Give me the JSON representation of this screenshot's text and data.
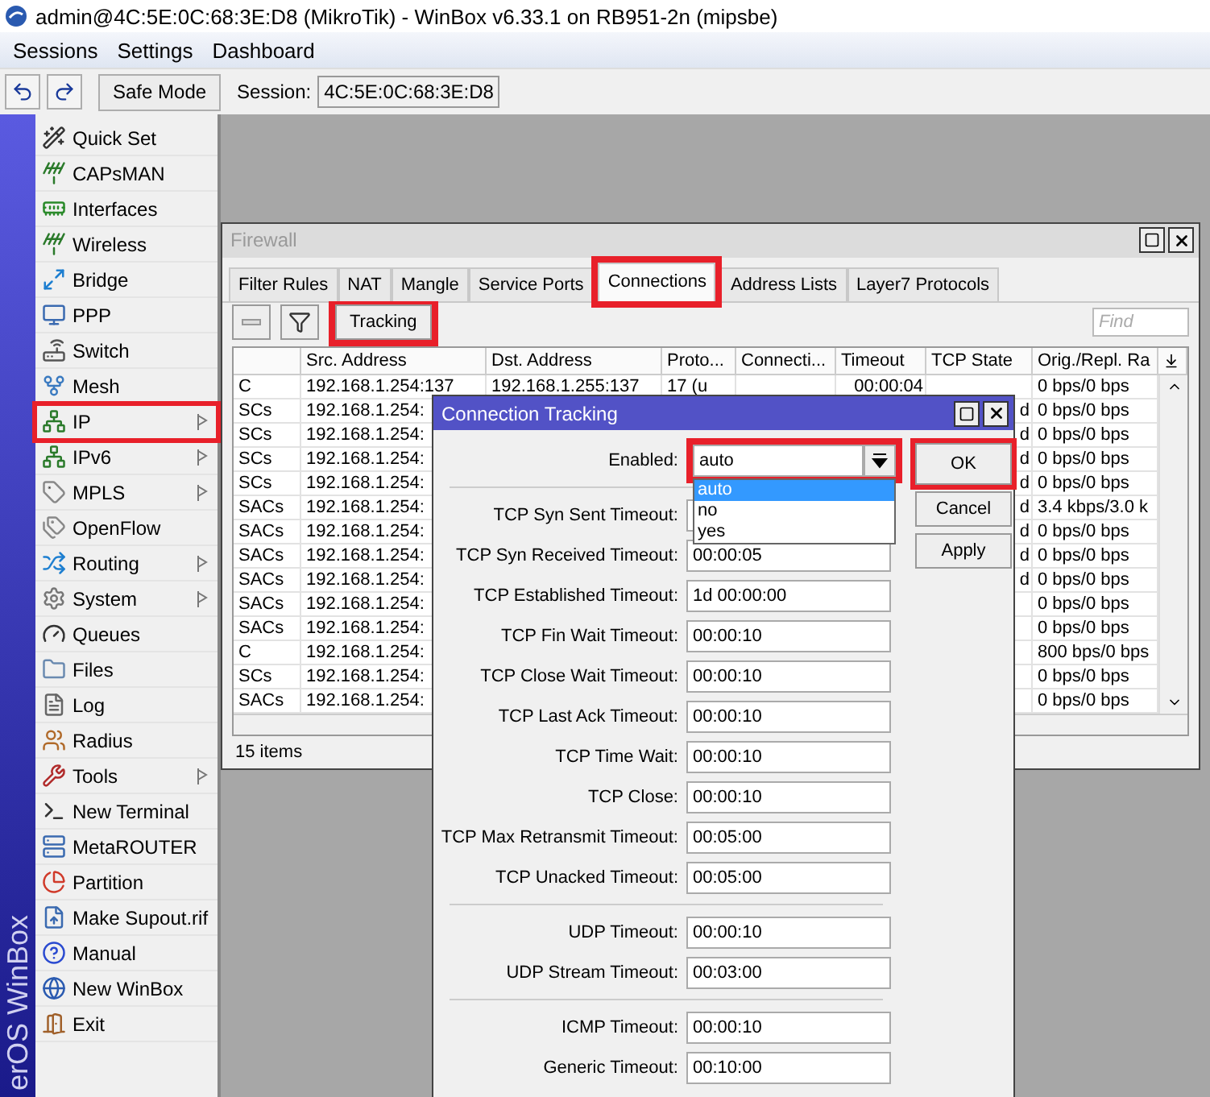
{
  "window": {
    "title": "admin@4C:5E:0C:68:3E:D8 (MikroTik) - WinBox v6.33.1 on RB951-2n (mipsbe)"
  },
  "menu": [
    "Sessions",
    "Settings",
    "Dashboard"
  ],
  "toolbar": {
    "safe_mode": "Safe Mode",
    "session_label": "Session:",
    "session_value": "4C:5E:0C:68:3E:D8"
  },
  "brand": "erOS WinBox",
  "sidebar": {
    "items": [
      {
        "label": "Quick Set",
        "submenu": false,
        "highlighted": false
      },
      {
        "label": "CAPsMAN",
        "submenu": false,
        "highlighted": false
      },
      {
        "label": "Interfaces",
        "submenu": false,
        "highlighted": false
      },
      {
        "label": "Wireless",
        "submenu": false,
        "highlighted": false
      },
      {
        "label": "Bridge",
        "submenu": false,
        "highlighted": false
      },
      {
        "label": "PPP",
        "submenu": false,
        "highlighted": false
      },
      {
        "label": "Switch",
        "submenu": false,
        "highlighted": false
      },
      {
        "label": "Mesh",
        "submenu": false,
        "highlighted": false
      },
      {
        "label": "IP",
        "submenu": true,
        "highlighted": true
      },
      {
        "label": "IPv6",
        "submenu": true,
        "highlighted": false
      },
      {
        "label": "MPLS",
        "submenu": true,
        "highlighted": false
      },
      {
        "label": "OpenFlow",
        "submenu": false,
        "highlighted": false
      },
      {
        "label": "Routing",
        "submenu": true,
        "highlighted": false
      },
      {
        "label": "System",
        "submenu": true,
        "highlighted": false
      },
      {
        "label": "Queues",
        "submenu": false,
        "highlighted": false
      },
      {
        "label": "Files",
        "submenu": false,
        "highlighted": false
      },
      {
        "label": "Log",
        "submenu": false,
        "highlighted": false
      },
      {
        "label": "Radius",
        "submenu": false,
        "highlighted": false
      },
      {
        "label": "Tools",
        "submenu": true,
        "highlighted": false
      },
      {
        "label": "New Terminal",
        "submenu": false,
        "highlighted": false
      },
      {
        "label": "MetaROUTER",
        "submenu": false,
        "highlighted": false
      },
      {
        "label": "Partition",
        "submenu": false,
        "highlighted": false
      },
      {
        "label": "Make Supout.rif",
        "submenu": false,
        "highlighted": false
      },
      {
        "label": "Manual",
        "submenu": false,
        "highlighted": false
      },
      {
        "label": "New WinBox",
        "submenu": false,
        "highlighted": false
      },
      {
        "label": "Exit",
        "submenu": false,
        "highlighted": false
      }
    ]
  },
  "firewall": {
    "title": "Firewall",
    "tabs": [
      {
        "label": "Filter Rules",
        "selected": false,
        "highlighted": false
      },
      {
        "label": "NAT",
        "selected": false,
        "highlighted": false
      },
      {
        "label": "Mangle",
        "selected": false,
        "highlighted": false
      },
      {
        "label": "Service Ports",
        "selected": false,
        "highlighted": false
      },
      {
        "label": "Connections",
        "selected": true,
        "highlighted": true
      },
      {
        "label": "Address Lists",
        "selected": false,
        "highlighted": false
      },
      {
        "label": "Layer7 Protocols",
        "selected": false,
        "highlighted": false
      }
    ],
    "tracking_button": {
      "label": "Tracking",
      "highlighted": true
    },
    "find": {
      "placeholder": "Find"
    },
    "columns": [
      "Src. Address",
      "Dst. Address",
      "Proto...",
      "Connecti...",
      "Timeout",
      "TCP State",
      "Orig./Repl. Ra"
    ],
    "rows": [
      {
        "flag": "C",
        "src": "192.168.1.254:137",
        "dst": "192.168.1.255:137",
        "proto": "17 (u",
        "timeout": "00:00:04",
        "rate": "0 bps/0 bps"
      },
      {
        "flag": "SCs",
        "src": "192.168.1.254:",
        "tcp_state": "d",
        "rate": "0 bps/0 bps"
      },
      {
        "flag": "SCs",
        "src": "192.168.1.254:",
        "tcp_state": "d",
        "rate": "0 bps/0 bps"
      },
      {
        "flag": "SCs",
        "src": "192.168.1.254:",
        "tcp_state": "d",
        "rate": "0 bps/0 bps"
      },
      {
        "flag": "SCs",
        "src": "192.168.1.254:",
        "tcp_state": "d",
        "rate": "0 bps/0 bps"
      },
      {
        "flag": "SACs",
        "src": "192.168.1.254:",
        "tcp_state": "d",
        "rate": "3.4 kbps/3.0 k"
      },
      {
        "flag": "SACs",
        "src": "192.168.1.254:",
        "tcp_state": "d",
        "rate": "0 bps/0 bps"
      },
      {
        "flag": "SACs",
        "src": "192.168.1.254:",
        "tcp_state": "d",
        "rate": "0 bps/0 bps"
      },
      {
        "flag": "SACs",
        "src": "192.168.1.254:",
        "tcp_state": "d",
        "rate": "0 bps/0 bps"
      },
      {
        "flag": "SACs",
        "src": "192.168.1.254:",
        "rate": "0 bps/0 bps"
      },
      {
        "flag": "SACs",
        "src": "192.168.1.254:",
        "rate": "0 bps/0 bps"
      },
      {
        "flag": "C",
        "src": "192.168.1.254:",
        "rate": "800 bps/0 bps"
      },
      {
        "flag": "SCs",
        "src": "192.168.1.254:",
        "rate": "0 bps/0 bps"
      },
      {
        "flag": "SACs",
        "src": "192.168.1.254:",
        "rate": "0 bps/0 bps"
      }
    ],
    "status": "15 items"
  },
  "dialog": {
    "title": "Connection Tracking",
    "enabled": {
      "label": "Enabled:",
      "value": "auto",
      "highlighted": true,
      "options": [
        {
          "label": "auto",
          "selected": true
        },
        {
          "label": "no",
          "selected": false
        },
        {
          "label": "yes",
          "selected": false
        }
      ]
    },
    "groups": [
      [
        {
          "label": "TCP Syn Sent Timeout:"
        },
        {
          "label": "TCP Syn Received Timeout:",
          "value": "00:00:05"
        },
        {
          "label": "TCP Established Timeout:",
          "value": "1d 00:00:00"
        },
        {
          "label": "TCP Fin Wait Timeout:",
          "value": "00:00:10"
        },
        {
          "label": "TCP Close Wait Timeout:",
          "value": "00:00:10"
        },
        {
          "label": "TCP Last Ack Timeout:",
          "value": "00:00:10"
        },
        {
          "label": "TCP Time Wait:",
          "value": "00:00:10"
        },
        {
          "label": "TCP Close:",
          "value": "00:00:10"
        },
        {
          "label": "TCP Max Retransmit Timeout:",
          "value": "00:05:00"
        },
        {
          "label": "TCP Unacked Timeout:",
          "value": "00:05:00"
        }
      ],
      [
        {
          "label": "UDP Timeout:",
          "value": "00:00:10"
        },
        {
          "label": "UDP Stream Timeout:",
          "value": "00:03:00"
        }
      ],
      [
        {
          "label": "ICMP Timeout:",
          "value": "00:00:10"
        },
        {
          "label": "Generic Timeout:",
          "value": "00:10:00"
        }
      ]
    ],
    "buttons": [
      {
        "label": "OK",
        "highlighted": true
      },
      {
        "label": "Cancel",
        "highlighted": false
      },
      {
        "label": "Apply",
        "highlighted": false
      }
    ]
  }
}
